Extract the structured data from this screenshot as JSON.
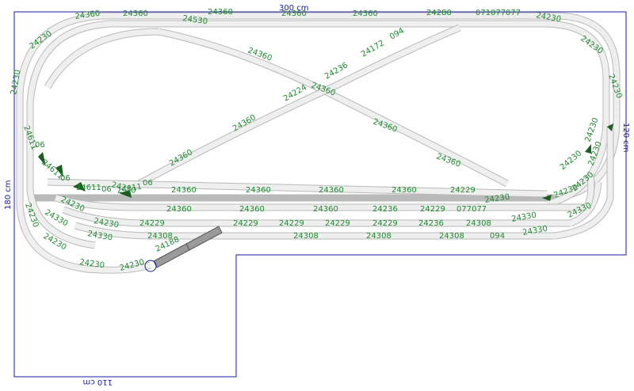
{
  "dimensions": {
    "top": "300 cm",
    "right": "120 cm",
    "left": "180 cm",
    "bottom": "110 cm"
  },
  "colors": {
    "border": "#1a1aa0",
    "label": "#1e8a2e",
    "track_rail": "#b9b9b9",
    "track_bed": "#efefef",
    "switch": "#1b5e20",
    "bridge": "#8a8a8a"
  },
  "track_labels": [
    "24360",
    "24360",
    "24360",
    "24360",
    "24360",
    "24288",
    "071077",
    "077",
    "24230",
    "24230",
    "24230",
    "24230",
    "24230",
    "24530",
    "24360",
    "24236",
    "24172",
    "094",
    "24360",
    "24360",
    "24360",
    "24224",
    "24236",
    "24360",
    "24360",
    "24360",
    "24611",
    "06",
    "24611",
    "06",
    "24611",
    "06",
    "24611",
    "06",
    "24360",
    "24360",
    "24360",
    "24360",
    "24229",
    "24360",
    "24360",
    "24360",
    "24236",
    "24229",
    "077077",
    "24229",
    "24229",
    "24229",
    "24229",
    "24229",
    "24236",
    "24308",
    "24308",
    "24308",
    "24308",
    "24308",
    "094",
    "24230",
    "24230",
    "24330",
    "24330",
    "24330",
    "24330",
    "24330",
    "24230",
    "24230",
    "24230",
    "24230",
    "24188",
    "24230",
    "24230",
    "24230",
    "24230",
    "24230",
    "24230",
    "24230",
    "24230",
    "24230",
    "24230",
    "24230",
    "24230",
    "24230"
  ]
}
